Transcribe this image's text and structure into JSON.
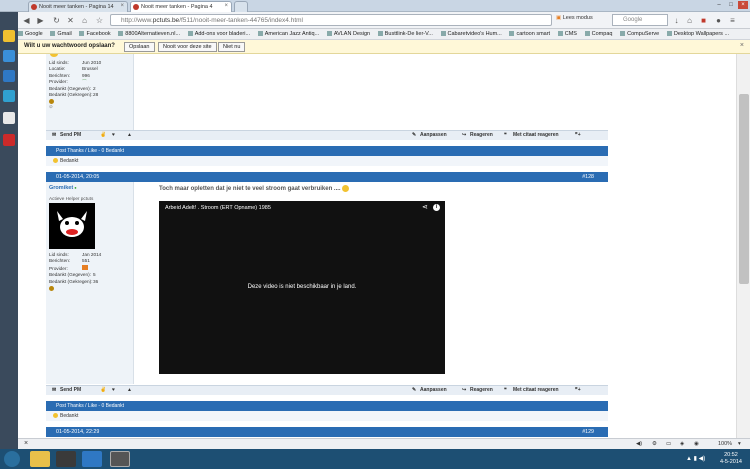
{
  "browser": {
    "tabs": [
      {
        "title": "Nooit meer tanken - Pagina 14",
        "active": false
      },
      {
        "title": "Nooit meer tanken - Pagina 4",
        "active": true
      }
    ],
    "url_prefix": "http://www.",
    "url_domain": "pctuts.be",
    "url_rest": "/f511/nooit-meer-tanken-44765/index4.html",
    "read_mode": "Lees modus",
    "search_placeholder": "Google",
    "zoom": "100%"
  },
  "bookmarks": [
    "Google",
    "Gmail",
    "Facebook",
    "8800Alternatieven.nl...",
    "Add-ons voor bladeri...",
    "American Jazz Antiq...",
    "AVLAN Design",
    "Busttlink-De lier-V...",
    "Cabaretvideo's Hum...",
    "cartoon smart",
    "CMS",
    "Compaq",
    "CompuServe",
    "Desktop Wallpapers ..."
  ],
  "password_bar": {
    "question": "Wilt u uw wachtwoord opslaan?",
    "save": "Opslaan",
    "never": "Nooit voor deze site",
    "not_now": "Niet nu"
  },
  "post1": {
    "fields": [
      {
        "k": "Lid sinds:",
        "v": "Jun 2010"
      },
      {
        "k": "Locatie:",
        "v": "Brussel"
      },
      {
        "k": "Berichten:",
        "v": "996"
      },
      {
        "k": "Provider:",
        "v": ""
      },
      {
        "k": "Bedankt (Gegeven):",
        "v": "2"
      },
      {
        "k": "Bedankt (Gekregen):",
        "v": "28"
      }
    ],
    "thanks_bar": "Post Thanks / Like - 0 Bedankt",
    "thanks_list": "Bedankt"
  },
  "actions": {
    "send_pm": "Send PM",
    "edit": "Aanpassen",
    "reply": "Reageren",
    "quote": "Met citaat reageren"
  },
  "post2": {
    "date": "01-05-2014, 20:05",
    "number": "#128",
    "username": "Gromiket",
    "user_title": "Actieve Helper pctuts",
    "fields": [
      {
        "k": "Lid sinds:",
        "v": "Jan 2014"
      },
      {
        "k": "Berichten:",
        "v": "551"
      },
      {
        "k": "Provider:",
        "v": ""
      },
      {
        "k": "Bedankt (Gegeven):",
        "v": "5"
      },
      {
        "k": "Bedankt (Gekregen):",
        "v": "36"
      }
    ],
    "message": "Toch maar opletten dat je niet te veel stroom gaat verbruiken ....",
    "video_title": "Arbeid Adelt! . Stroom (ERT Opname) 1985",
    "video_error": "Deze video is niet beschikbaar in je land.",
    "thanks_bar": "Post Thanks / Like - 0 Bedankt",
    "thanks_list": "Bedankt"
  },
  "post3": {
    "date": "01-05-2014, 22:29",
    "number": "#129"
  },
  "clock": {
    "time": "20:52",
    "date": "4-5-2014"
  }
}
